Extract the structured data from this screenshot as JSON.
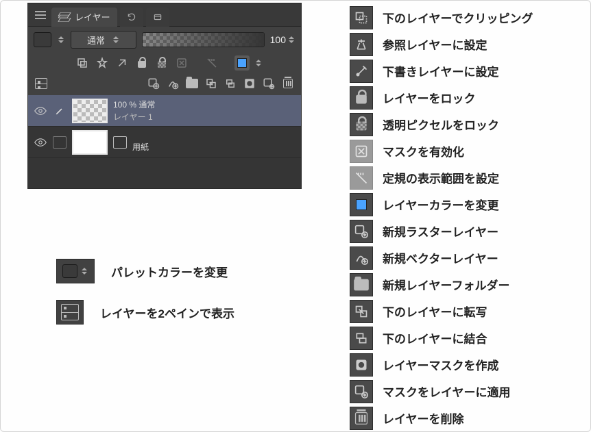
{
  "panel": {
    "tab_label": "レイヤー",
    "blend_mode": "通常",
    "opacity": "100",
    "layers": [
      {
        "opacity_label": "100 % 通常",
        "name": "レイヤー 1"
      },
      {
        "name": "用紙"
      }
    ]
  },
  "legend": {
    "palette_color": "パレットカラーを変更",
    "two_pane": "レイヤーを2ペインで表示"
  },
  "icon_list": [
    {
      "icon": "clip-icon",
      "label": "下のレイヤーでクリッピング"
    },
    {
      "icon": "reference-icon",
      "label": "参照レイヤーに設定"
    },
    {
      "icon": "draft-icon",
      "label": "下書きレイヤーに設定"
    },
    {
      "icon": "lock-icon",
      "label": "レイヤーをロック"
    },
    {
      "icon": "lock-alpha-icon",
      "label": "透明ピクセルをロック"
    },
    {
      "icon": "mask-enable-icon",
      "label": "マスクを有効化"
    },
    {
      "icon": "ruler-range-icon",
      "label": "定規の表示範囲を設定"
    },
    {
      "icon": "layer-color-icon",
      "label": "レイヤーカラーを変更"
    },
    {
      "icon": "new-raster-icon",
      "label": "新規ラスターレイヤー"
    },
    {
      "icon": "new-vector-icon",
      "label": "新規ベクターレイヤー"
    },
    {
      "icon": "new-folder-icon",
      "label": "新規レイヤーフォルダー"
    },
    {
      "icon": "transfer-icon",
      "label": "下のレイヤーに転写"
    },
    {
      "icon": "merge-down-icon",
      "label": "下のレイヤーに結合"
    },
    {
      "icon": "create-mask-icon",
      "label": "レイヤーマスクを作成"
    },
    {
      "icon": "apply-mask-icon",
      "label": "マスクをレイヤーに適用"
    },
    {
      "icon": "delete-icon",
      "label": "レイヤーを削除"
    }
  ]
}
